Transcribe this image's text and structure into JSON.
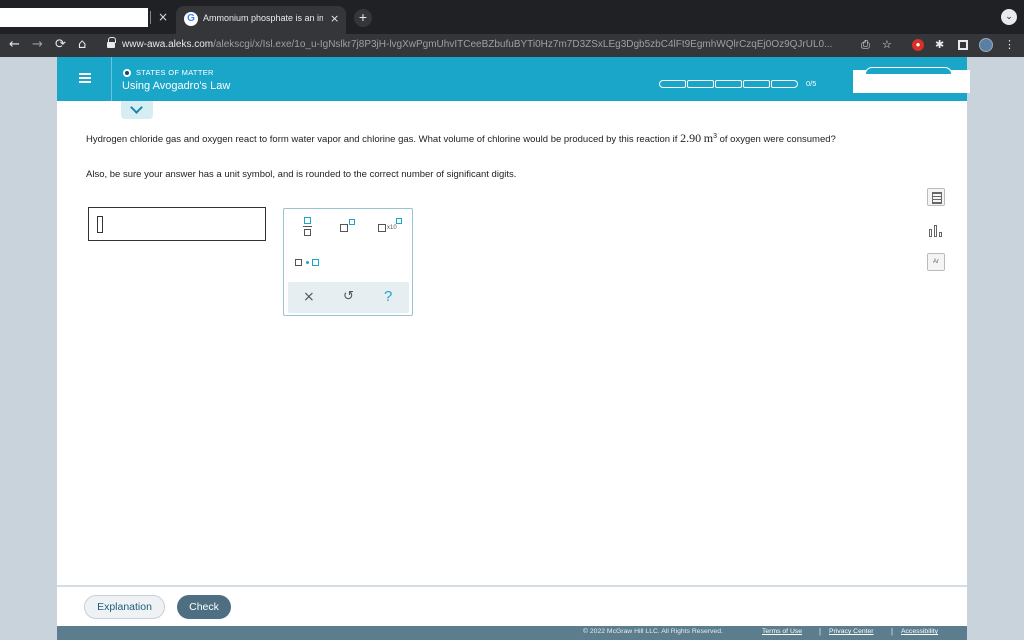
{
  "browser": {
    "tabs": [
      {
        "title": ""
      },
      {
        "title": "Ammonium phosphate is an im",
        "favicon": "G"
      }
    ],
    "close_glyph": "×",
    "new_tab_glyph": "+",
    "menu_glyph": "⌄",
    "nav": {
      "back": "←",
      "forward": "→",
      "reload": "⟳",
      "home": "⌂"
    },
    "url_host": "www-awa.aleks.com",
    "url_path": "/alekscgi/x/Isl.exe/1o_u-IgNslkr7j8P3jH-lvgXwPgmUhvITCeeBZbufuBYTi0Hz7m7D3ZSxLEg3Dgb5zbC4lFt9EgmhWQlrCzqEj0Oz9QJrUL0...",
    "extension_icons": [
      "share-icon",
      "star-icon",
      "adblock-icon",
      "puzzle-icon",
      "sidebar-icon",
      "profile-avatar",
      "kebab-menu-icon"
    ],
    "star_glyph": "☆",
    "puzzle_glyph": "✱",
    "kebab_glyph": "⋮",
    "share_glyph": "⎙"
  },
  "header": {
    "topic_label": "STATES OF MATTER",
    "topic_title": "Using Avogadro's Law",
    "progress": {
      "completed": 0,
      "total": 5,
      "label": "0/5",
      "segments": 5
    }
  },
  "question": {
    "text_before": "Hydrogen chloride gas and oxygen react to form water vapor and chlorine gas. What volume of chlorine would be produced by this reaction if ",
    "value": "2.90",
    "unit": "m",
    "unit_exp": "3",
    "text_after": " of oxygen were consumed?",
    "instruction": "Also, be sure your answer has a unit symbol, and is rounded to the correct number of significant digits."
  },
  "palette": {
    "x10_label": "x10",
    "clear_glyph": "×",
    "undo_glyph": "↺",
    "help_glyph": "?"
  },
  "side_tools": {
    "periodic_label": "Ar"
  },
  "footer": {
    "explanation_label": "Explanation",
    "check_label": "Check",
    "copyright": "© 2022 McGraw Hill LLC. All Rights Reserved.",
    "terms": "Terms of Use",
    "privacy": "Privacy Center",
    "accessibility": "Accessibility",
    "separator": "|"
  },
  "colors": {
    "brand": "#1aa6c8",
    "check_button": "#4e6f81",
    "footer_bar": "#5b7d8e"
  }
}
